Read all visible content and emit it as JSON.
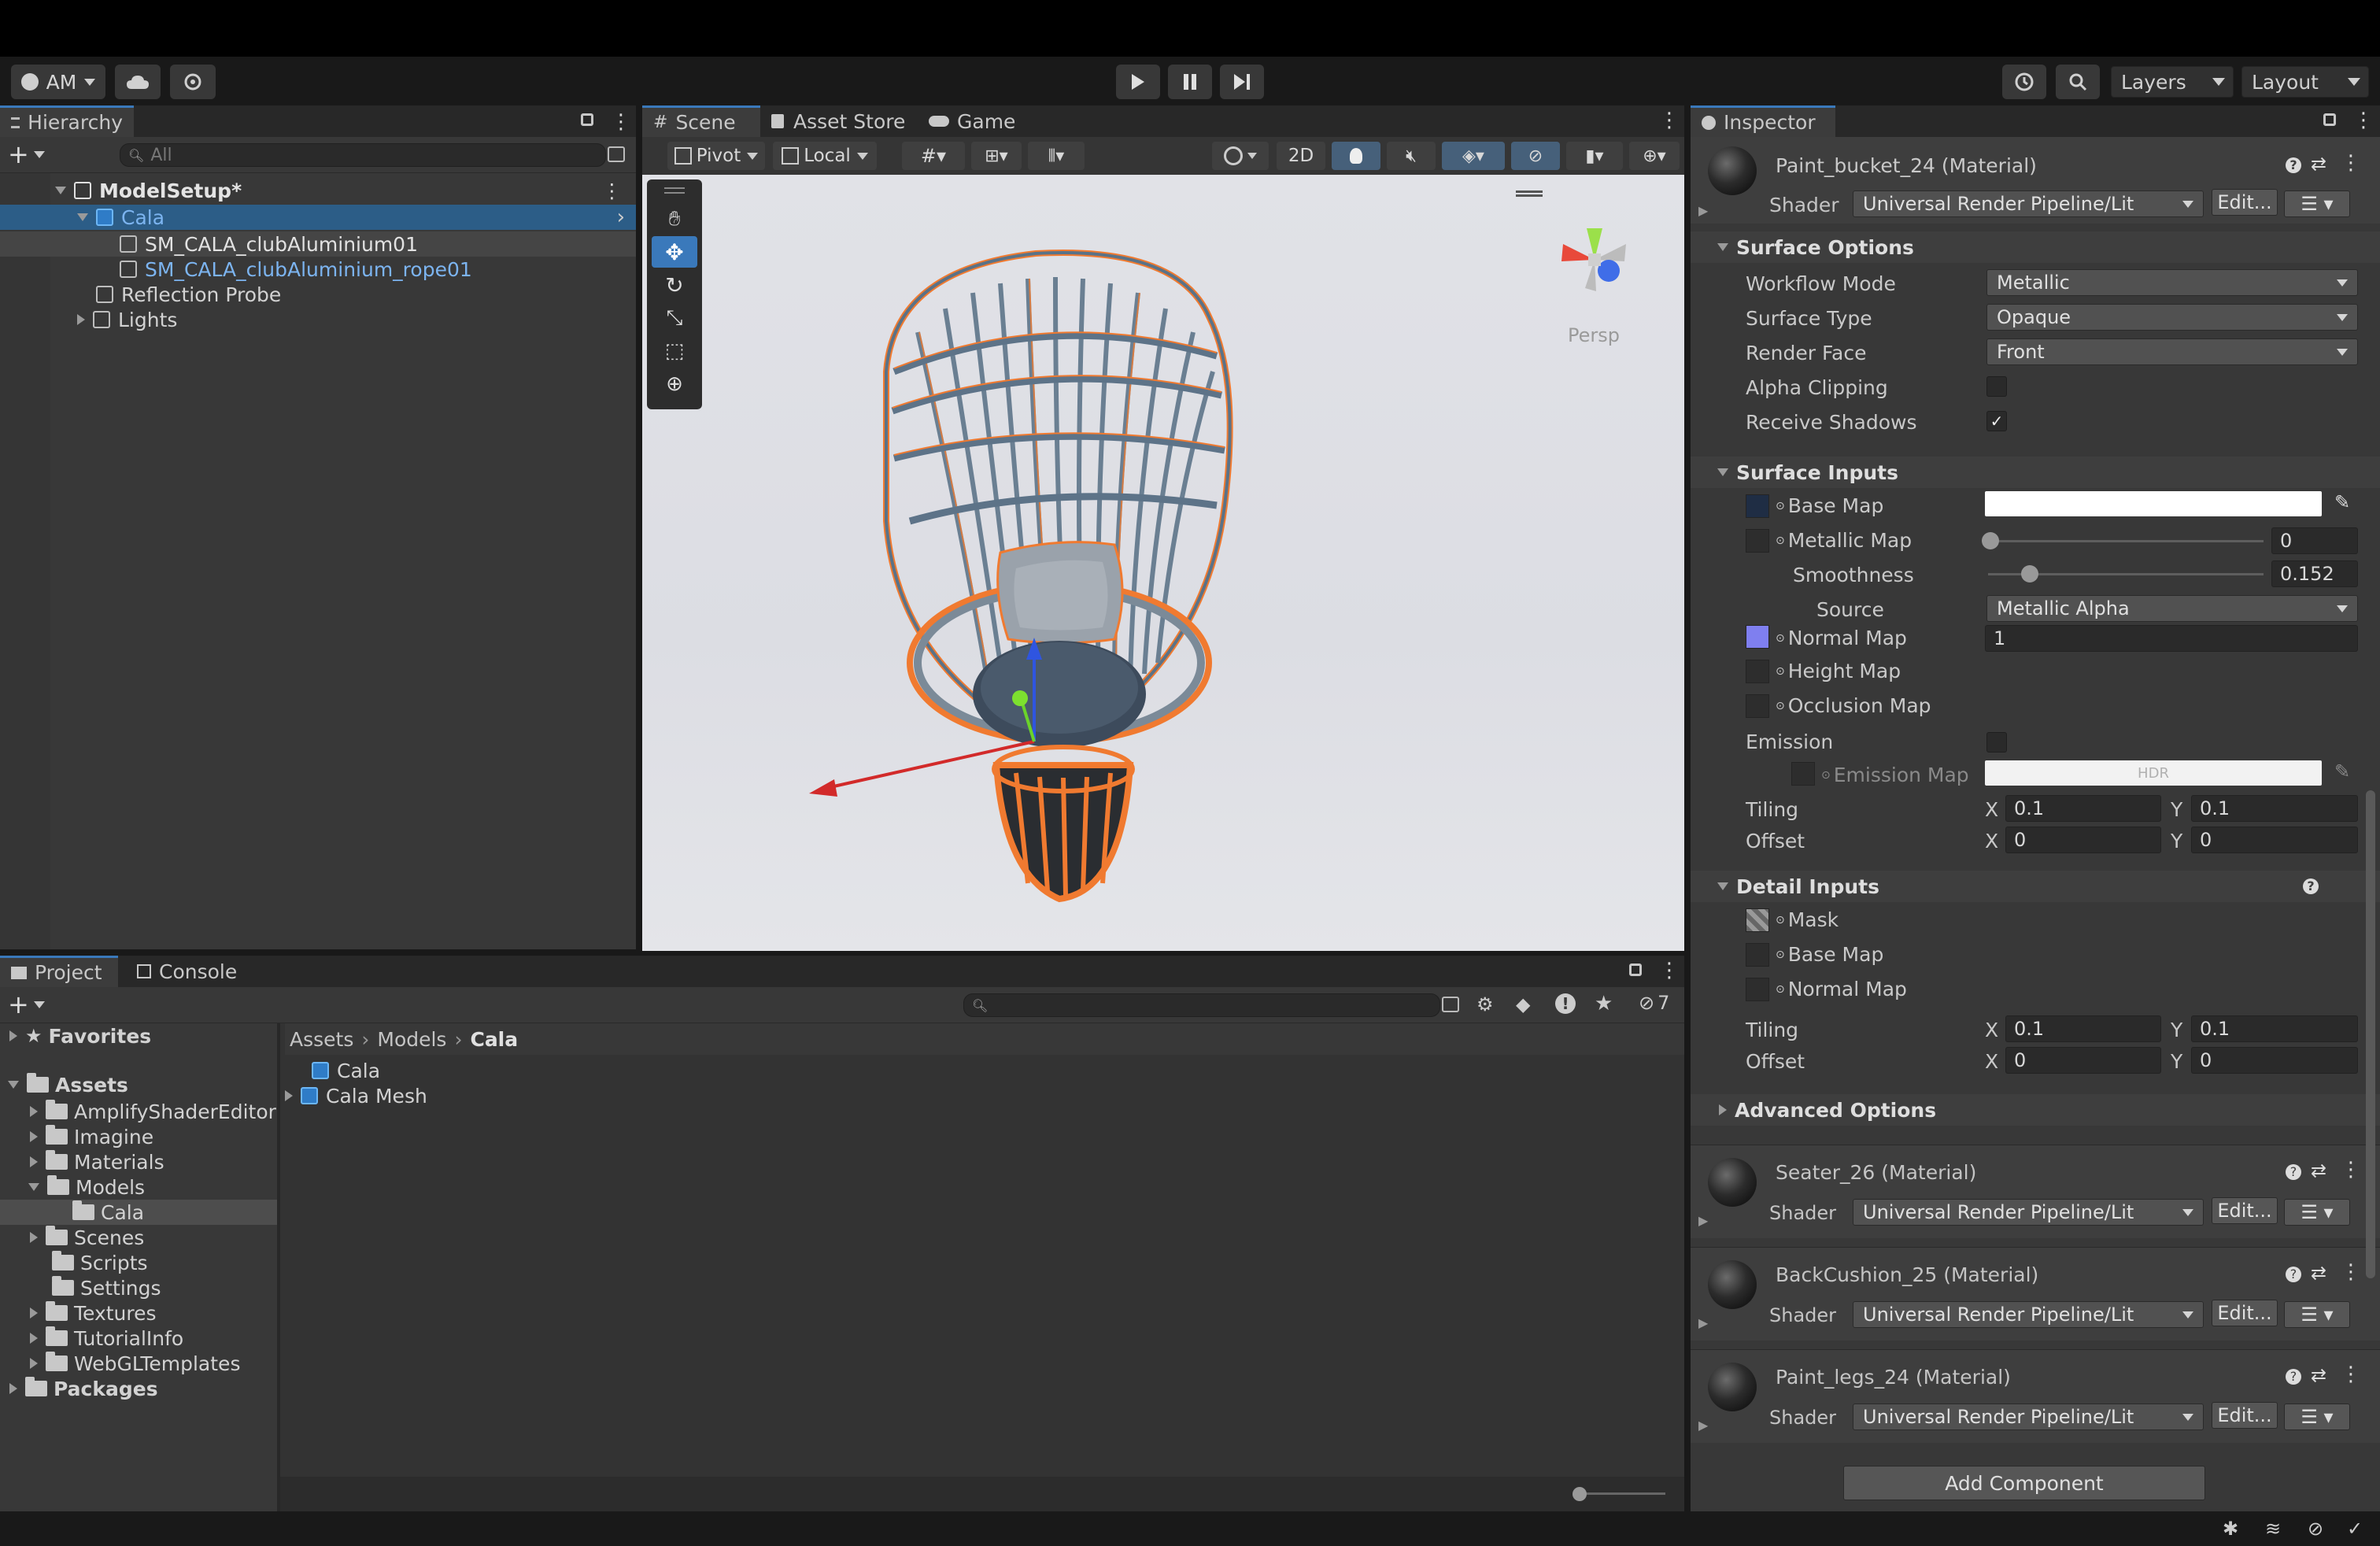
{
  "toolbar": {
    "account": "AM",
    "layers": "Layers",
    "layout": "Layout"
  },
  "hierarchy": {
    "tab": "Hierarchy",
    "search_placeholder": "All",
    "items": [
      {
        "label": "ModelSetup*"
      },
      {
        "label": "Cala"
      },
      {
        "label": "SM_CALA_clubAluminium01"
      },
      {
        "label": "SM_CALA_clubAluminium_rope01"
      },
      {
        "label": "Reflection Probe"
      },
      {
        "label": "Lights"
      }
    ]
  },
  "scene": {
    "tabs": [
      "Scene",
      "Asset Store",
      "Game"
    ],
    "pivot": "Pivot",
    "local": "Local",
    "mode2d": "2D",
    "persp": "Persp"
  },
  "project": {
    "tabs": [
      "Project",
      "Console"
    ],
    "hidden_count": "7",
    "favorites": "Favorites",
    "assets": "Assets",
    "folders": [
      "AmplifyShaderEditor",
      "Imagine",
      "Materials",
      "Models",
      "Cala",
      "Scenes",
      "Scripts",
      "Settings",
      "Textures",
      "TutorialInfo",
      "WebGLTemplates"
    ],
    "packages": "Packages",
    "breadcrumb": [
      "Assets",
      "Models",
      "Cala"
    ],
    "items": [
      "Cala",
      "Cala Mesh"
    ]
  },
  "inspector": {
    "tab": "Inspector",
    "material1": {
      "name": "Paint_bucket_24 (Material)",
      "shader_label": "Shader",
      "shader": "Universal Render Pipeline/Lit",
      "edit": "Edit..."
    },
    "surface_options": {
      "title": "Surface Options",
      "rows": [
        {
          "label": "Workflow Mode",
          "value": "Metallic"
        },
        {
          "label": "Surface Type",
          "value": "Opaque"
        },
        {
          "label": "Render Face",
          "value": "Front"
        }
      ],
      "alpha_clipping": "Alpha Clipping",
      "receive_shadows": "Receive Shadows"
    },
    "surface_inputs": {
      "title": "Surface Inputs",
      "base_map": "Base Map",
      "metallic_map": "Metallic Map",
      "metallic_value": "0",
      "smoothness": "Smoothness",
      "smoothness_value": "0.152",
      "smoothness_level": 0.152,
      "source": "Source",
      "source_value": "Metallic Alpha",
      "normal_map": "Normal Map",
      "normal_value": "1",
      "height_map": "Height Map",
      "occlusion_map": "Occlusion Map",
      "emission": "Emission",
      "emission_map": "Emission Map",
      "hdr": "HDR",
      "tiling": "Tiling",
      "offset": "Offset",
      "tiling_x": "0.1",
      "tiling_y": "0.1",
      "offset_x": "0",
      "offset_y": "0"
    },
    "detail_inputs": {
      "title": "Detail Inputs",
      "mask": "Mask",
      "base_map": "Base Map",
      "normal_map": "Normal Map",
      "tiling": "Tiling",
      "offset": "Offset",
      "tiling_x": "0.1",
      "tiling_y": "0.1",
      "offset_x": "0",
      "offset_y": "0"
    },
    "advanced": "Advanced Options",
    "materials": [
      {
        "name": "Seater_26 (Material)",
        "shader_label": "Shader",
        "shader": "Universal Render Pipeline/Lit",
        "edit": "Edit..."
      },
      {
        "name": "BackCushion_25 (Material)",
        "shader_label": "Shader",
        "shader": "Universal Render Pipeline/Lit",
        "edit": "Edit..."
      },
      {
        "name": "Paint_legs_24 (Material)",
        "shader_label": "Shader",
        "shader": "Universal Render Pipeline/Lit",
        "edit": "Edit..."
      }
    ],
    "add_component": "Add Component",
    "xlabel": "X",
    "ylabel": "Y"
  },
  "colors": {
    "accent": "#3a79bb",
    "selection": "#2c5d87",
    "text_blue": "#7cb4f0"
  }
}
